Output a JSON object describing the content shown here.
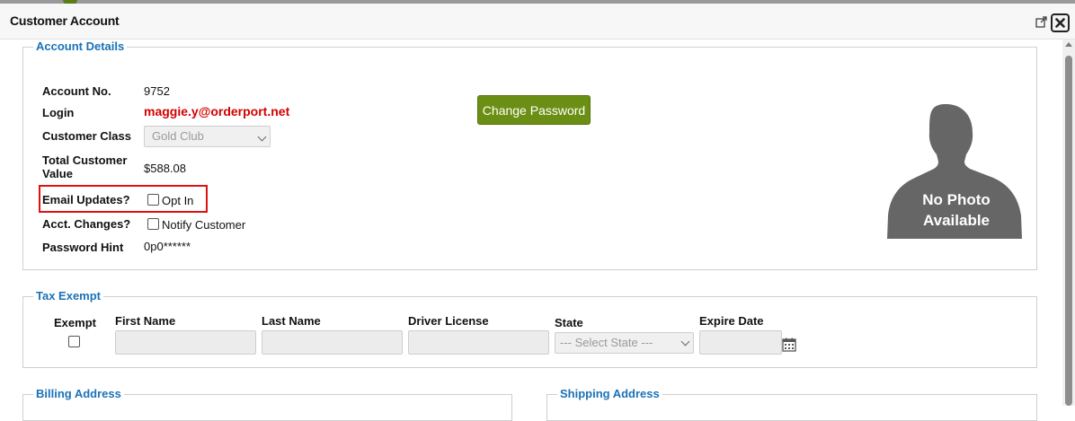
{
  "window": {
    "title": "Customer Account",
    "popout_icon": "popout-icon",
    "close_icon": "close-icon"
  },
  "account_details": {
    "legend": "Account Details",
    "account_no_label": "Account No.",
    "account_no_value": "9752",
    "login_label": "Login",
    "login_value": "maggie.y@orderport.net",
    "customer_class_label": "Customer Class",
    "customer_class_value": "Gold Club",
    "total_value_label_line1": "Total Customer",
    "total_value_label_line2": "Value",
    "total_value": "$588.08",
    "email_updates_label": "Email Updates?",
    "email_updates_option": "Opt In",
    "email_updates_checked": false,
    "acct_changes_label": "Acct. Changes?",
    "acct_changes_option": "Notify Customer",
    "acct_changes_checked": false,
    "password_hint_label": "Password Hint",
    "password_hint_value": "0p0******",
    "change_password_button": "Change Password",
    "photo_text_line1": "No Photo",
    "photo_text_line2": "Available",
    "highlight_color": "#e01010",
    "accent_color": "#6b8f14"
  },
  "tax_exempt": {
    "legend": "Tax Exempt",
    "exempt_label": "Exempt",
    "exempt_checked": false,
    "first_name_label": "First Name",
    "first_name_value": "",
    "last_name_label": "Last Name",
    "last_name_value": "",
    "driver_license_label": "Driver License",
    "driver_license_value": "",
    "state_label": "State",
    "state_value": "--- Select State ---",
    "expire_date_label": "Expire Date",
    "expire_date_value": "",
    "calendar_icon": "calendar-icon"
  },
  "billing_address": {
    "legend": "Billing Address"
  },
  "shipping_address": {
    "legend": "Shipping Address"
  }
}
